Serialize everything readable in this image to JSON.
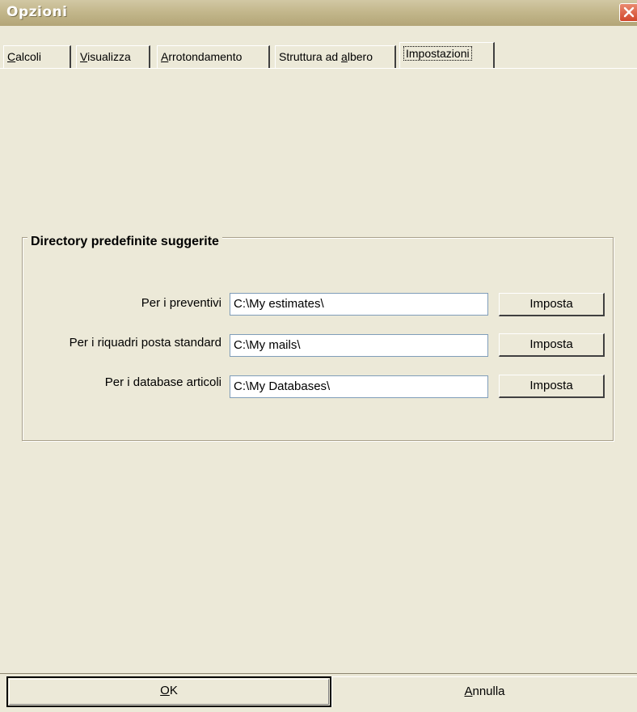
{
  "window": {
    "title": "Opzioni"
  },
  "tabs": [
    {
      "mnemonic": "C",
      "rest": "alcoli"
    },
    {
      "mnemonic": "V",
      "rest": "isualizza"
    },
    {
      "mnemonic": "A",
      "rest": "rrotondamento"
    },
    {
      "before": "Struttura ad ",
      "mnemonic": "a",
      "rest": "lbero"
    },
    {
      "label": "Impostazioni",
      "active": true
    }
  ],
  "group": {
    "title": "Directory predefinite suggerite",
    "rows": [
      {
        "label": "Per i preventivi",
        "value": "C:\\My estimates\\",
        "button": "Imposta"
      },
      {
        "label": "Per i riquadri posta standard",
        "value": "C:\\My mails\\",
        "button": "Imposta"
      },
      {
        "label": "Per i database articoli",
        "value": "C:\\My Databases\\",
        "button": "Imposta"
      }
    ]
  },
  "buttons": {
    "ok_mnemonic": "O",
    "ok_rest": "K",
    "cancel_mnemonic": "A",
    "cancel_rest": "nnulla"
  },
  "colors": {
    "face": "#ece9d8",
    "close": "#d1462b"
  }
}
